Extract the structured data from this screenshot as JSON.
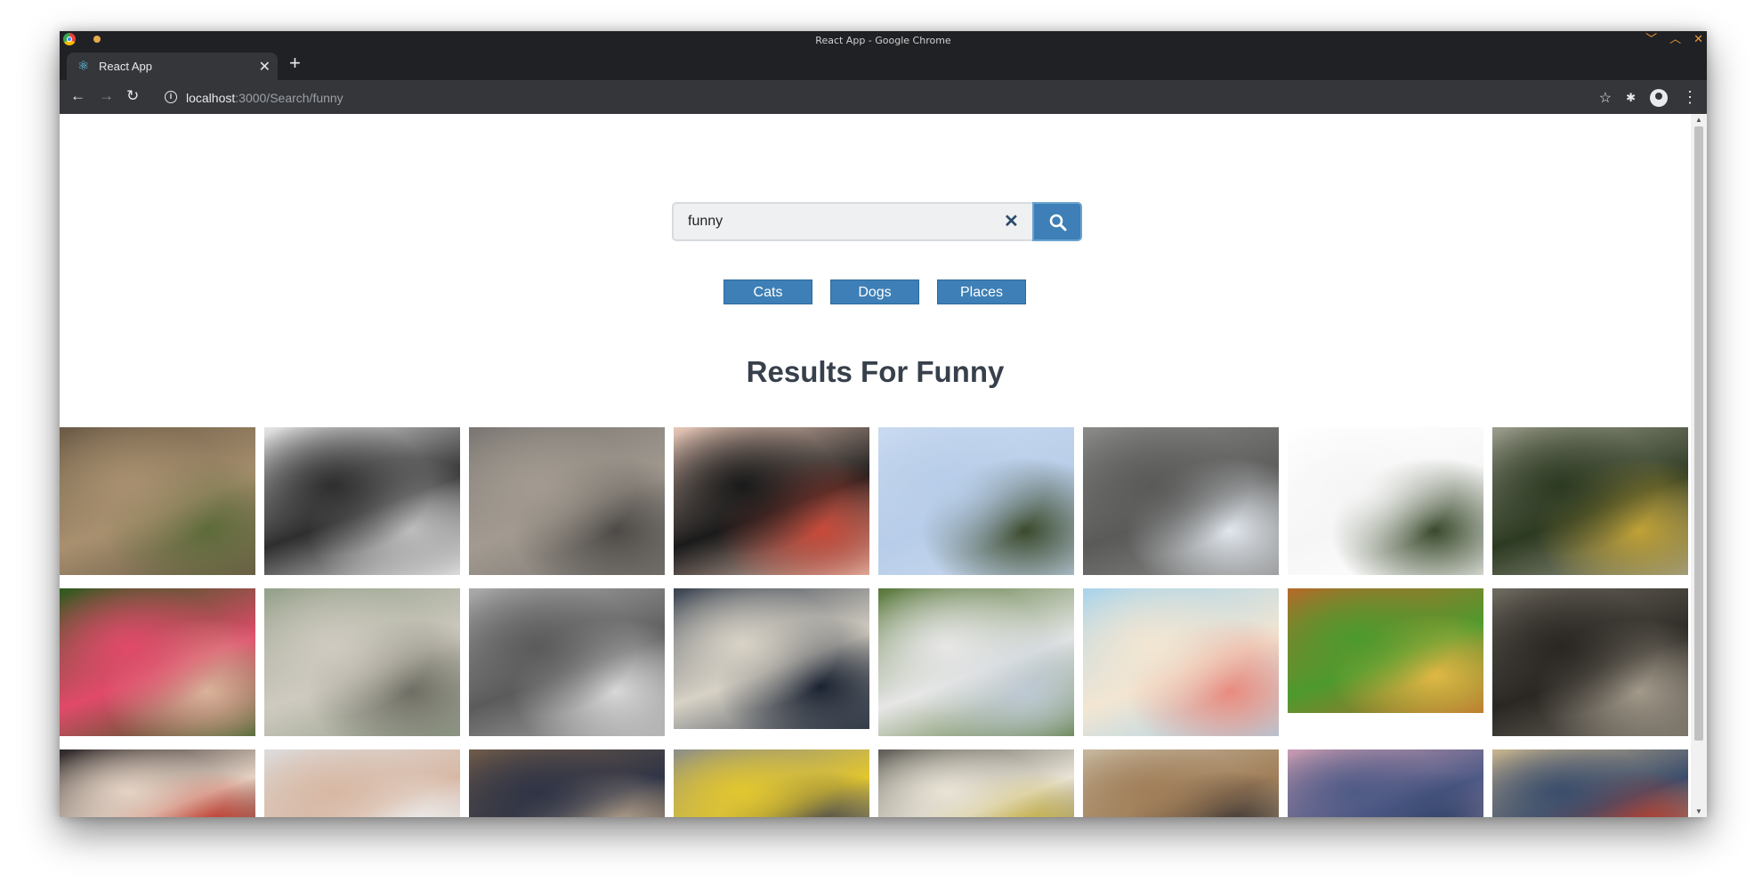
{
  "window": {
    "title": "React App - Google Chrome"
  },
  "tabs": [
    {
      "label": "React App",
      "close": "✕"
    }
  ],
  "new_tab": "+",
  "toolbar": {
    "back": "←",
    "forward": "→",
    "reload": "↻",
    "url_host": "localhost",
    "url_path": ":3000/Search/funny",
    "bookmark": "☆",
    "extensions": "🧩",
    "menu": "⋮"
  },
  "search": {
    "value": "funny",
    "clear": "✕"
  },
  "nav_links": [
    "Cats",
    "Dogs",
    "Places"
  ],
  "results_title": "Results For Funny",
  "colors": {
    "accent": "#3d7fb6",
    "title_text": "#37404b",
    "chrome_dark": "#202124",
    "chrome_toolbar": "#35363a"
  },
  "images": [
    {
      "name": "hyena-photo",
      "colors": [
        "#6b5a46",
        "#a8906f",
        "#5d6b3a"
      ]
    },
    {
      "name": "mona-lisa-sketch-photo",
      "colors": [
        "#e6e6e6",
        "#2e2e2e",
        "#bdbdbd"
      ]
    },
    {
      "name": "grey-cat-photo",
      "colors": [
        "#7a7672",
        "#a39b91",
        "#4d4a47"
      ]
    },
    {
      "name": "clown-face-photo",
      "colors": [
        "#e8c8b8",
        "#1a1a1a",
        "#c84a3a"
      ]
    },
    {
      "name": "acrobats-sky-photo",
      "colors": [
        "#c9daf0",
        "#b8cde9",
        "#3b4a2c"
      ]
    },
    {
      "name": "tower-performer-photo",
      "colors": [
        "#8a8a88",
        "#5a5a58",
        "#e1e7ee"
      ]
    },
    {
      "name": "mime-swing-photo",
      "colors": [
        "#ffffff",
        "#f6f6f6",
        "#3a4a2c"
      ]
    },
    {
      "name": "parade-performers-photo",
      "colors": [
        "#9b9c8c",
        "#2d3a22",
        "#c0a136"
      ]
    },
    {
      "name": "balloon-woman-photo",
      "colors": [
        "#2f5a1e",
        "#e14a6a",
        "#d9b39a"
      ]
    },
    {
      "name": "laughing-men-photo",
      "colors": [
        "#94a08a",
        "#cfcac0",
        "#6f6e64"
      ]
    },
    {
      "name": "party-hats-bw-photo",
      "colors": [
        "#aaaaaa",
        "#5b5b5b",
        "#d8d8d8"
      ]
    },
    {
      "name": "puffin-photo",
      "colors": [
        "#3a4350",
        "#d8d2c6",
        "#1b2332"
      ]
    },
    {
      "name": "statues-photo",
      "colors": [
        "#58773a",
        "#e7e7e7",
        "#bdc9d4"
      ]
    },
    {
      "name": "flamingos-photo",
      "colors": [
        "#a9d4ea",
        "#f3e6d2",
        "#e98b7e"
      ]
    },
    {
      "name": "lion-art-photo",
      "colors": [
        "#b46b2a",
        "#4d9a2e",
        "#e0b845"
      ]
    },
    {
      "name": "bears-photo",
      "colors": [
        "#6f6a60",
        "#2a2723",
        "#a39a8b"
      ]
    },
    {
      "name": "women-street-photo",
      "colors": [
        "#2b2526",
        "#e5d3c4",
        "#c63a2c"
      ]
    },
    {
      "name": "bald-man-photo",
      "colors": [
        "#dcdcdc",
        "#d8b8a4",
        "#eeeeee"
      ]
    },
    {
      "name": "electric-cart-photo",
      "colors": [
        "#6f5a48",
        "#2f3446",
        "#b9a790"
      ]
    },
    {
      "name": "taxi-toy-photo",
      "colors": [
        "#8d8e88",
        "#e2c62f",
        "#4a4a48"
      ]
    },
    {
      "name": "bus-toy-photo",
      "colors": [
        "#5e5c56",
        "#e9e4d6",
        "#c9b347"
      ]
    },
    {
      "name": "dog-blanket-photo",
      "colors": [
        "#c6b79f",
        "#a07e58",
        "#3a3230"
      ]
    },
    {
      "name": "sea-sunset-photo",
      "colors": [
        "#c79bb0",
        "#4e5a86",
        "#2a3f66"
      ]
    },
    {
      "name": "scarecrow-photo",
      "colors": [
        "#c8b48e",
        "#3a4d6c",
        "#b33a2c"
      ]
    }
  ]
}
